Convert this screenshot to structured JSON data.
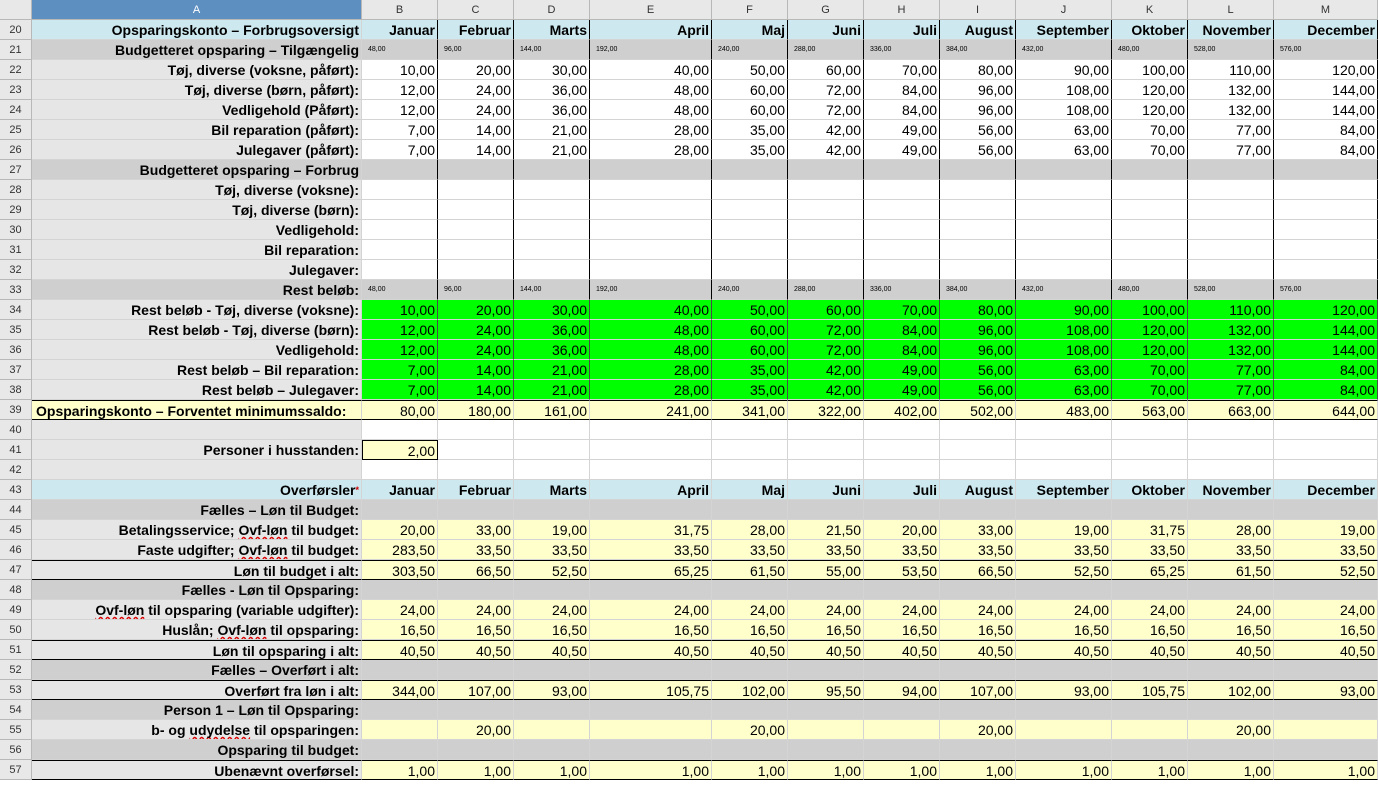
{
  "cols": {
    "letters": [
      "A",
      "B",
      "C",
      "D",
      "E",
      "F",
      "G",
      "H",
      "I",
      "J",
      "K",
      "L",
      "M"
    ]
  },
  "rows": [
    {
      "n": "20",
      "label": "Opsparingskonto – Forbrugsoversigt",
      "vals": [
        "Januar",
        "Februar",
        "Marts",
        "April",
        "Maj",
        "Juni",
        "Juli",
        "August",
        "September",
        "Oktober",
        "November",
        "December"
      ],
      "fill": "blue",
      "bold": true,
      "lbold": true
    },
    {
      "n": "21",
      "label": "Budgetteret opsparing – Tilgængelig",
      "vals": [
        "48,00",
        "96,00",
        "144,00",
        "192,00",
        "240,00",
        "288,00",
        "336,00",
        "384,00",
        "432,00",
        "480,00",
        "528,00",
        "576,00"
      ],
      "fill": "gray",
      "small": true,
      "lbold": true
    },
    {
      "n": "22",
      "label": "Tøj, diverse (voksne, påført):",
      "vals": [
        "10,00",
        "20,00",
        "30,00",
        "40,00",
        "50,00",
        "60,00",
        "70,00",
        "80,00",
        "90,00",
        "100,00",
        "110,00",
        "120,00"
      ],
      "fill": "white",
      "lbold": true
    },
    {
      "n": "23",
      "label": "Tøj, diverse (børn, påført):",
      "vals": [
        "12,00",
        "24,00",
        "36,00",
        "48,00",
        "60,00",
        "72,00",
        "84,00",
        "96,00",
        "108,00",
        "120,00",
        "132,00",
        "144,00"
      ],
      "fill": "white",
      "lbold": true
    },
    {
      "n": "24",
      "label": "Vedligehold (Påført):",
      "vals": [
        "12,00",
        "24,00",
        "36,00",
        "48,00",
        "60,00",
        "72,00",
        "84,00",
        "96,00",
        "108,00",
        "120,00",
        "132,00",
        "144,00"
      ],
      "fill": "white",
      "lbold": true
    },
    {
      "n": "25",
      "label": "Bil reparation (påført):",
      "vals": [
        "7,00",
        "14,00",
        "21,00",
        "28,00",
        "35,00",
        "42,00",
        "49,00",
        "56,00",
        "63,00",
        "70,00",
        "77,00",
        "84,00"
      ],
      "fill": "white",
      "lbold": true
    },
    {
      "n": "26",
      "label": "Julegaver (påført):",
      "vals": [
        "7,00",
        "14,00",
        "21,00",
        "28,00",
        "35,00",
        "42,00",
        "49,00",
        "56,00",
        "63,00",
        "70,00",
        "77,00",
        "84,00"
      ],
      "fill": "white",
      "lbold": true
    },
    {
      "n": "27",
      "label": "Budgetteret opsparing – Forbrug",
      "vals": [
        "",
        "",
        "",
        "",
        "",
        "",
        "",
        "",
        "",
        "",
        "",
        ""
      ],
      "fill": "gray",
      "lbold": true
    },
    {
      "n": "28",
      "label": "Tøj, diverse (voksne):",
      "vals": [
        "",
        "",
        "",
        "",
        "",
        "",
        "",
        "",
        "",
        "",
        "",
        ""
      ],
      "fill": "white",
      "lbold": true
    },
    {
      "n": "29",
      "label": "Tøj, diverse (børn):",
      "vals": [
        "",
        "",
        "",
        "",
        "",
        "",
        "",
        "",
        "",
        "",
        "",
        ""
      ],
      "fill": "white",
      "lbold": true
    },
    {
      "n": "30",
      "label": "Vedligehold:",
      "vals": [
        "",
        "",
        "",
        "",
        "",
        "",
        "",
        "",
        "",
        "",
        "",
        ""
      ],
      "fill": "white",
      "lbold": true
    },
    {
      "n": "31",
      "label": "Bil reparation:",
      "vals": [
        "",
        "",
        "",
        "",
        "",
        "",
        "",
        "",
        "",
        "",
        "",
        ""
      ],
      "fill": "white",
      "lbold": true
    },
    {
      "n": "32",
      "label": "Julegaver:",
      "vals": [
        "",
        "",
        "",
        "",
        "",
        "",
        "",
        "",
        "",
        "",
        "",
        ""
      ],
      "fill": "white",
      "lbold": true
    },
    {
      "n": "33",
      "label": "Rest beløb:",
      "vals": [
        "48,00",
        "96,00",
        "144,00",
        "192,00",
        "240,00",
        "288,00",
        "336,00",
        "384,00",
        "432,00",
        "480,00",
        "528,00",
        "576,00"
      ],
      "fill": "gray",
      "small": true,
      "lbold": true
    },
    {
      "n": "34",
      "label": "Rest beløb - Tøj, diverse (voksne):",
      "vals": [
        "10,00",
        "20,00",
        "30,00",
        "40,00",
        "50,00",
        "60,00",
        "70,00",
        "80,00",
        "90,00",
        "100,00",
        "110,00",
        "120,00"
      ],
      "fill": "green",
      "lbold": true
    },
    {
      "n": "35",
      "label": "Rest beløb - Tøj, diverse (børn):",
      "vals": [
        "12,00",
        "24,00",
        "36,00",
        "48,00",
        "60,00",
        "72,00",
        "84,00",
        "96,00",
        "108,00",
        "120,00",
        "132,00",
        "144,00"
      ],
      "fill": "green",
      "lbold": true
    },
    {
      "n": "36",
      "label": "Vedligehold:",
      "vals": [
        "12,00",
        "24,00",
        "36,00",
        "48,00",
        "60,00",
        "72,00",
        "84,00",
        "96,00",
        "108,00",
        "120,00",
        "132,00",
        "144,00"
      ],
      "fill": "green",
      "lbold": true
    },
    {
      "n": "37",
      "label": "Rest beløb – Bil reparation:",
      "vals": [
        "7,00",
        "14,00",
        "21,00",
        "28,00",
        "35,00",
        "42,00",
        "49,00",
        "56,00",
        "63,00",
        "70,00",
        "77,00",
        "84,00"
      ],
      "fill": "green",
      "lbold": true
    },
    {
      "n": "38",
      "label": "Rest beløb – Julegaver:",
      "vals": [
        "7,00",
        "14,00",
        "21,00",
        "28,00",
        "35,00",
        "42,00",
        "49,00",
        "56,00",
        "63,00",
        "70,00",
        "77,00",
        "84,00"
      ],
      "fill": "green",
      "lbold": true
    },
    {
      "n": "39",
      "label": "Opsparingskonto – Forventet minimumssaldo:",
      "vals": [
        "80,00",
        "180,00",
        "161,00",
        "241,00",
        "341,00",
        "322,00",
        "402,00",
        "502,00",
        "483,00",
        "563,00",
        "663,00",
        "644,00"
      ],
      "fill": "yellow",
      "lbold": true,
      "lyellow": true
    },
    {
      "n": "40",
      "label": "",
      "vals": [
        "",
        "",
        "",
        "",
        "",
        "",
        "",
        "",
        "",
        "",
        "",
        ""
      ],
      "fill": "white"
    },
    {
      "n": "41",
      "label": "Personer i husstanden:",
      "vals": [
        "2,00",
        "",
        "",
        "",
        "",
        "",
        "",
        "",
        "",
        "",
        "",
        ""
      ],
      "fill": "white",
      "lbold": true,
      "onlyB": true
    },
    {
      "n": "42",
      "label": "",
      "vals": [
        "",
        "",
        "",
        "",
        "",
        "",
        "",
        "",
        "",
        "",
        "",
        ""
      ],
      "fill": "white"
    },
    {
      "n": "43",
      "label": "Overførsler",
      "vals": [
        "Januar",
        "Februar",
        "Marts",
        "April",
        "Maj",
        "Juni",
        "Juli",
        "August",
        "September",
        "Oktober",
        "November",
        "December"
      ],
      "fill": "blue",
      "bold": true,
      "lbold": true
    },
    {
      "n": "44",
      "label": "Fælles – Løn til Budget:",
      "vals": [
        "",
        "",
        "",
        "",
        "",
        "",
        "",
        "",
        "",
        "",
        "",
        ""
      ],
      "fill": "gray",
      "lbold": true
    },
    {
      "n": "45",
      "label": "Betalingsservice; Ovf-løn til budget:",
      "vals": [
        "20,00",
        "33,00",
        "19,00",
        "31,75",
        "28,00",
        "21,50",
        "20,00",
        "33,00",
        "19,00",
        "31,75",
        "28,00",
        "19,00"
      ],
      "fill": "yellow",
      "lbold": true
    },
    {
      "n": "46",
      "label": "Faste udgifter; Ovf-løn til budget:",
      "vals": [
        "283,50",
        "33,50",
        "33,50",
        "33,50",
        "33,50",
        "33,50",
        "33,50",
        "33,50",
        "33,50",
        "33,50",
        "33,50",
        "33,50"
      ],
      "fill": "yellow",
      "lbold": true
    },
    {
      "n": "47",
      "label": "Løn til budget i alt:",
      "vals": [
        "303,50",
        "66,50",
        "52,50",
        "65,25",
        "61,50",
        "55,00",
        "53,50",
        "66,50",
        "52,50",
        "65,25",
        "61,50",
        "52,50"
      ],
      "fill": "yellow",
      "lbold": true
    },
    {
      "n": "48",
      "label": "Fælles - Løn til Opsparing:",
      "vals": [
        "",
        "",
        "",
        "",
        "",
        "",
        "",
        "",
        "",
        "",
        "",
        ""
      ],
      "fill": "gray",
      "lbold": true
    },
    {
      "n": "49",
      "label": "Ovf-løn til opsparing (variable udgifter):",
      "vals": [
        "24,00",
        "24,00",
        "24,00",
        "24,00",
        "24,00",
        "24,00",
        "24,00",
        "24,00",
        "24,00",
        "24,00",
        "24,00",
        "24,00"
      ],
      "fill": "yellow",
      "lbold": true
    },
    {
      "n": "50",
      "label": "Huslån; Ovf-løn til opsparing:",
      "vals": [
        "16,50",
        "16,50",
        "16,50",
        "16,50",
        "16,50",
        "16,50",
        "16,50",
        "16,50",
        "16,50",
        "16,50",
        "16,50",
        "16,50"
      ],
      "fill": "yellow",
      "lbold": true
    },
    {
      "n": "51",
      "label": "Løn til opsparing i alt:",
      "vals": [
        "40,50",
        "40,50",
        "40,50",
        "40,50",
        "40,50",
        "40,50",
        "40,50",
        "40,50",
        "40,50",
        "40,50",
        "40,50",
        "40,50"
      ],
      "fill": "yellow",
      "lbold": true
    },
    {
      "n": "52",
      "label": "Fælles – Overført i alt:",
      "vals": [
        "",
        "",
        "",
        "",
        "",
        "",
        "",
        "",
        "",
        "",
        "",
        ""
      ],
      "fill": "gray",
      "lbold": true
    },
    {
      "n": "53",
      "label": "Overført fra løn i alt:",
      "vals": [
        "344,00",
        "107,00",
        "93,00",
        "105,75",
        "102,00",
        "95,50",
        "94,00",
        "107,00",
        "93,00",
        "105,75",
        "102,00",
        "93,00"
      ],
      "fill": "yellow",
      "lbold": true
    },
    {
      "n": "54",
      "label": "Person 1 – Løn til Opsparing:",
      "vals": [
        "",
        "",
        "",
        "",
        "",
        "",
        "",
        "",
        "",
        "",
        "",
        ""
      ],
      "fill": "gray",
      "lbold": true
    },
    {
      "n": "55",
      "label": "b- og udydelse til opsparingen:",
      "vals": [
        "",
        "20,00",
        "",
        "",
        "20,00",
        "",
        "",
        "20,00",
        "",
        "",
        "20,00",
        ""
      ],
      "fill": "yellow",
      "lbold": true
    },
    {
      "n": "56",
      "label": "Opsparing til budget:",
      "vals": [
        "",
        "",
        "",
        "",
        "",
        "",
        "",
        "",
        "",
        "",
        "",
        ""
      ],
      "fill": "gray",
      "lbold": true
    },
    {
      "n": "57",
      "label": "Ubenævnt overførsel:",
      "vals": [
        "1,00",
        "1,00",
        "1,00",
        "1,00",
        "1,00",
        "1,00",
        "1,00",
        "1,00",
        "1,00",
        "1,00",
        "1,00",
        "1,00"
      ],
      "fill": "yellow",
      "lbold": true
    }
  ],
  "colors": {
    "blue": "#cde8ef",
    "gray": "#cfcfcf",
    "green": "#00ff00",
    "yellow": "#ffffcc",
    "white": "#ffffff",
    "labelbg": "#e6e6e6"
  }
}
